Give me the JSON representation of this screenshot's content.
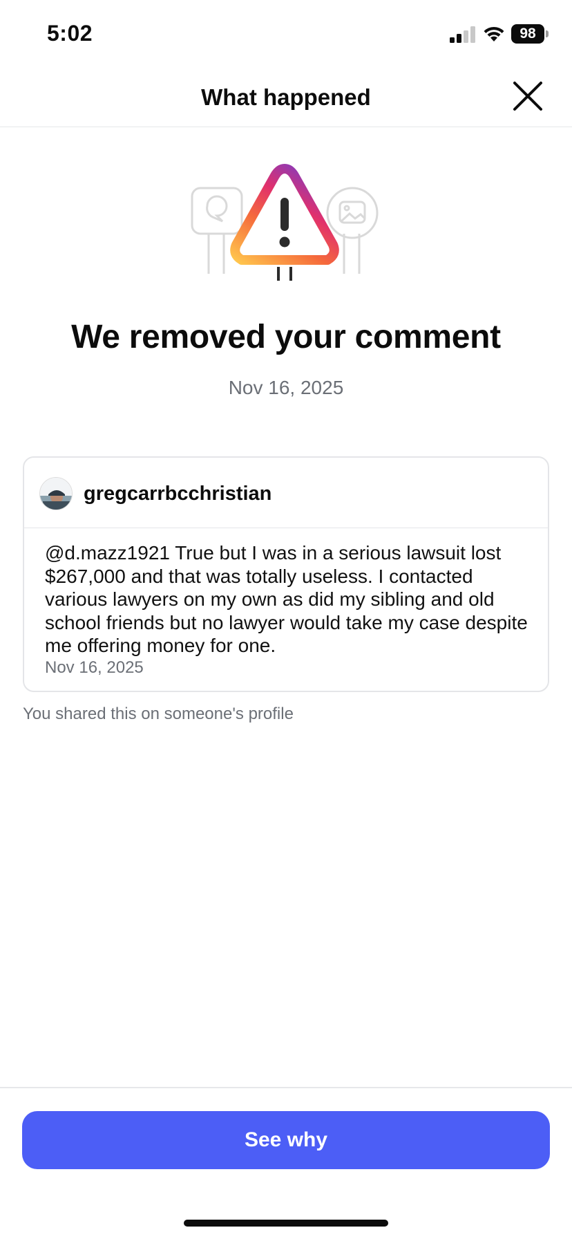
{
  "status_bar": {
    "time": "5:02",
    "battery_level": "98"
  },
  "header": {
    "title": "What happened"
  },
  "notice": {
    "title": "We removed your comment",
    "date": "Nov 16, 2025"
  },
  "comment_card": {
    "username": "gregcarrbcchristian",
    "text": "@d.mazz1921 True but I was in a serious lawsuit lost $267,000 and that was totally useless. I contacted various lawyers on my own as did my sibling and old school friends but no lawyer would take my case despite me offering money for one.",
    "date": "Nov 16, 2025"
  },
  "shared_note": "You shared this on someone's profile",
  "footer": {
    "button_label": "See why"
  },
  "colors": {
    "primary_button": "#4c5ef6",
    "muted_text": "#6b6f76",
    "divider": "#e6e7ea"
  }
}
